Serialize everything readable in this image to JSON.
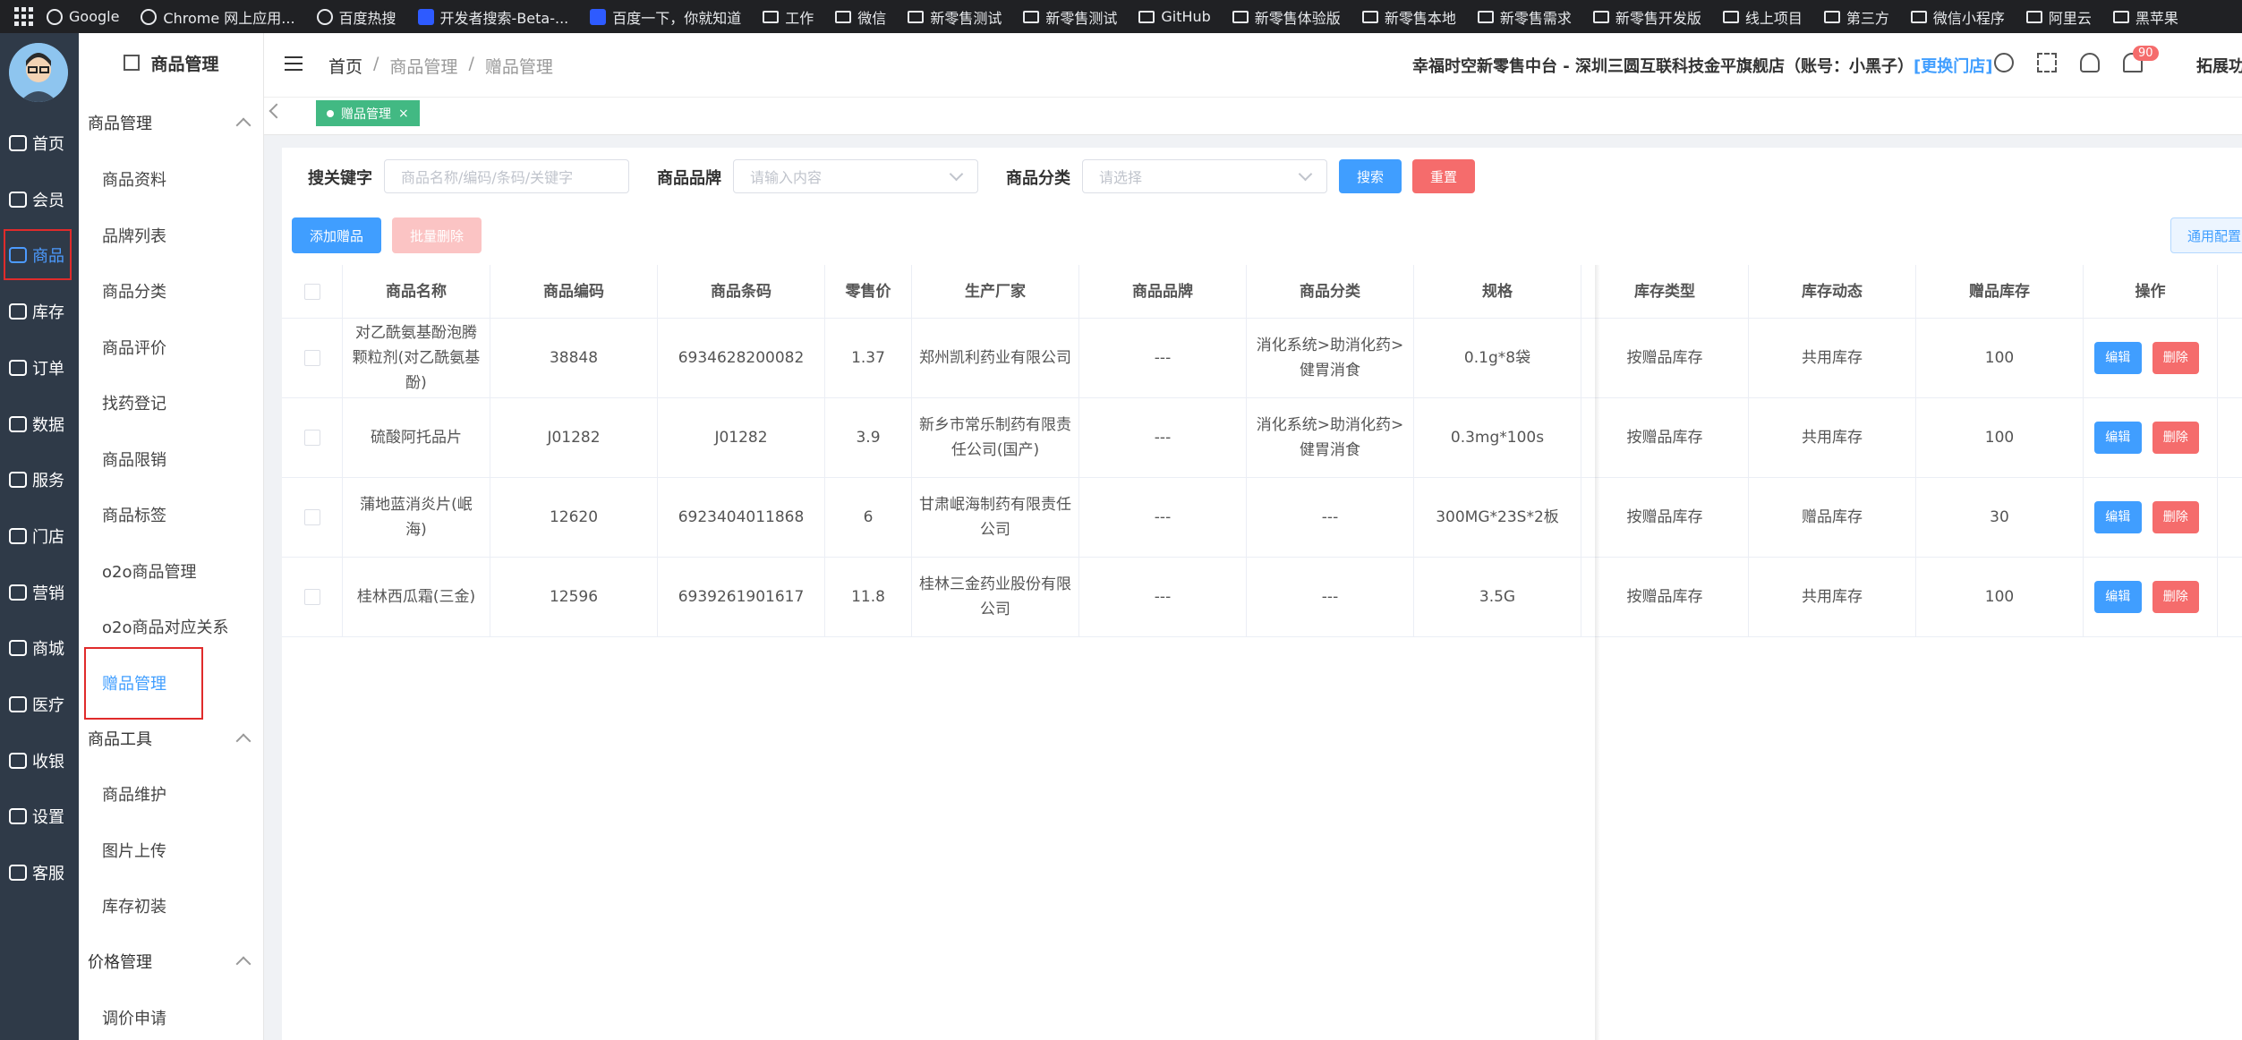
{
  "bookmarks": [
    {
      "label": "Google",
      "icon": "globe-icon"
    },
    {
      "label": "Chrome 网上应用...",
      "icon": "globe-icon"
    },
    {
      "label": "百度热搜",
      "icon": "globe-icon"
    },
    {
      "label": "开发者搜索-Beta-...",
      "icon": "blue-icon"
    },
    {
      "label": "百度一下，你就知道",
      "icon": "blue-icon"
    },
    {
      "label": "工作",
      "icon": "folder-icon"
    },
    {
      "label": "微信",
      "icon": "folder-icon"
    },
    {
      "label": "新零售测试",
      "icon": "folder-icon"
    },
    {
      "label": "新零售测试",
      "icon": "folder-icon"
    },
    {
      "label": "GitHub",
      "icon": "folder-icon"
    },
    {
      "label": "新零售体验版",
      "icon": "folder-icon"
    },
    {
      "label": "新零售本地",
      "icon": "folder-icon"
    },
    {
      "label": "新零售需求",
      "icon": "folder-icon"
    },
    {
      "label": "新零售开发版",
      "icon": "folder-icon"
    },
    {
      "label": "线上项目",
      "icon": "folder-icon"
    },
    {
      "label": "第三方",
      "icon": "folder-icon"
    },
    {
      "label": "微信小程序",
      "icon": "folder-icon"
    },
    {
      "label": "阿里云",
      "icon": "folder-icon"
    },
    {
      "label": "黑苹果",
      "icon": "folder-icon"
    }
  ],
  "rail": [
    {
      "label": "首页",
      "active": false
    },
    {
      "label": "会员",
      "active": false
    },
    {
      "label": "商品",
      "active": true
    },
    {
      "label": "库存",
      "active": false
    },
    {
      "label": "订单",
      "active": false
    },
    {
      "label": "数据",
      "active": false
    },
    {
      "label": "服务",
      "active": false
    },
    {
      "label": "门店",
      "active": false
    },
    {
      "label": "营销",
      "active": false
    },
    {
      "label": "商城",
      "active": false
    },
    {
      "label": "医疗",
      "active": false
    },
    {
      "label": "收银",
      "active": false
    },
    {
      "label": "设置",
      "active": false
    },
    {
      "label": "客服",
      "active": false
    }
  ],
  "subnav": {
    "title": "商品管理",
    "group1": "商品管理",
    "items1": [
      "商品资料",
      "品牌列表",
      "商品分类",
      "商品评价",
      "找药登记",
      "商品限销",
      "商品标签",
      "o2o商品管理",
      "o2o商品对应关系",
      "赠品管理"
    ],
    "group2": "商品工具",
    "items2": [
      "商品维护",
      "图片上传",
      "库存初装"
    ],
    "group3": "价格管理",
    "items3": [
      "调价申请"
    ]
  },
  "header": {
    "breadcrumb": [
      "首页",
      "商品管理",
      "赠品管理"
    ],
    "store_text": "幸福时空新零售中台 - 深圳三圆互联科技金平旗舰店（账号：小黑子）",
    "switch_store": "[更换门店]",
    "badge": "90",
    "expand": "拓展功"
  },
  "tabs": {
    "active": "赠品管理",
    "close": "×"
  },
  "filters": {
    "keyword_label": "搜关键字",
    "keyword_placeholder": "商品名称/编码/条码/关键字",
    "brand_label": "商品品牌",
    "brand_placeholder": "请输入内容",
    "category_label": "商品分类",
    "category_placeholder": "请选择",
    "search": "搜索",
    "reset": "重置",
    "add": "添加赠品",
    "batch_delete": "批量删除",
    "config": "通用配置"
  },
  "table": {
    "headers": [
      "商品名称",
      "商品编码",
      "商品条码",
      "零售价",
      "生产厂家",
      "商品品牌",
      "商品分类",
      "规格",
      "库存类型",
      "库存动态",
      "赠品库存",
      "操作"
    ],
    "edit": "编辑",
    "delete": "删除",
    "rows": [
      [
        "对乙酰氨基酚泡腾颗粒剂(对乙酰氨基酚)",
        "38848",
        "6934628200082",
        "1.37",
        "郑州凯利药业有限公司",
        "---",
        "消化系统>助消化药>健胃消食",
        "0.1g*8袋",
        "按赠品库存",
        "共用库存",
        "100"
      ],
      [
        "硫酸阿托品片",
        "J01282",
        "J01282",
        "3.9",
        "新乡市常乐制药有限责任公司(国产)",
        "---",
        "消化系统>助消化药>健胃消食",
        "0.3mg*100s",
        "按赠品库存",
        "共用库存",
        "100"
      ],
      [
        "蒲地蓝消炎片(岷海)",
        "12620",
        "6923404011868",
        "6",
        "甘肃岷海制药有限责任公司",
        "---",
        "---",
        "300MG*23S*2板",
        "按赠品库存",
        "赠品库存",
        "30"
      ],
      [
        "桂林西瓜霜(三金)",
        "12596",
        "6939261901617",
        "11.8",
        "桂林三金药业股份有限公司",
        "---",
        "---",
        "3.5G",
        "按赠品库存",
        "共用库存",
        "100"
      ]
    ]
  },
  "colors": {
    "primary": "#409eff",
    "danger": "#f56c6c",
    "tag": "#42b983",
    "rail": "#2f3a48"
  }
}
